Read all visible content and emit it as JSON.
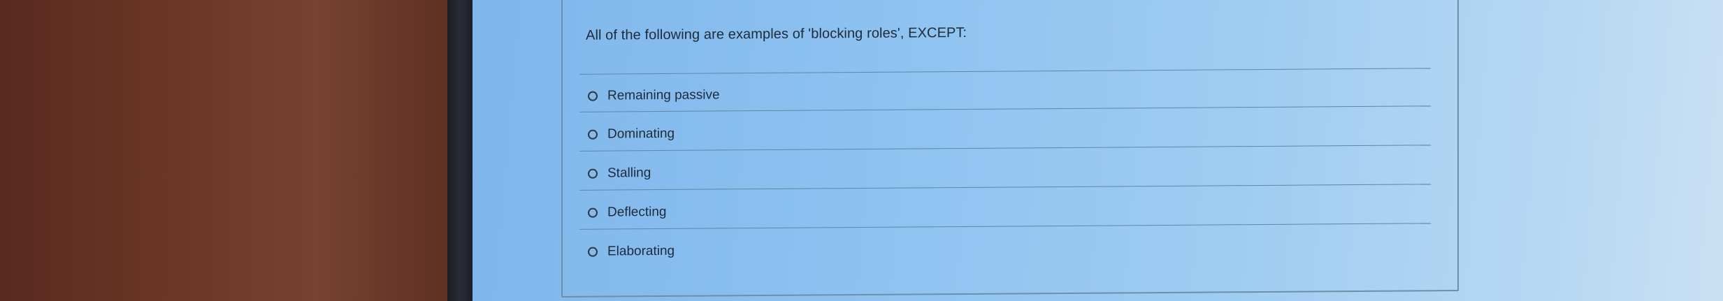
{
  "question": {
    "text": "All of the following are examples of 'blocking roles', EXCEPT:"
  },
  "options": [
    {
      "label": "Remaining passive",
      "selected": false
    },
    {
      "label": "Dominating",
      "selected": false
    },
    {
      "label": "Stalling",
      "selected": false
    },
    {
      "label": "Deflecting",
      "selected": false
    },
    {
      "label": "Elaborating",
      "selected": false
    }
  ]
}
